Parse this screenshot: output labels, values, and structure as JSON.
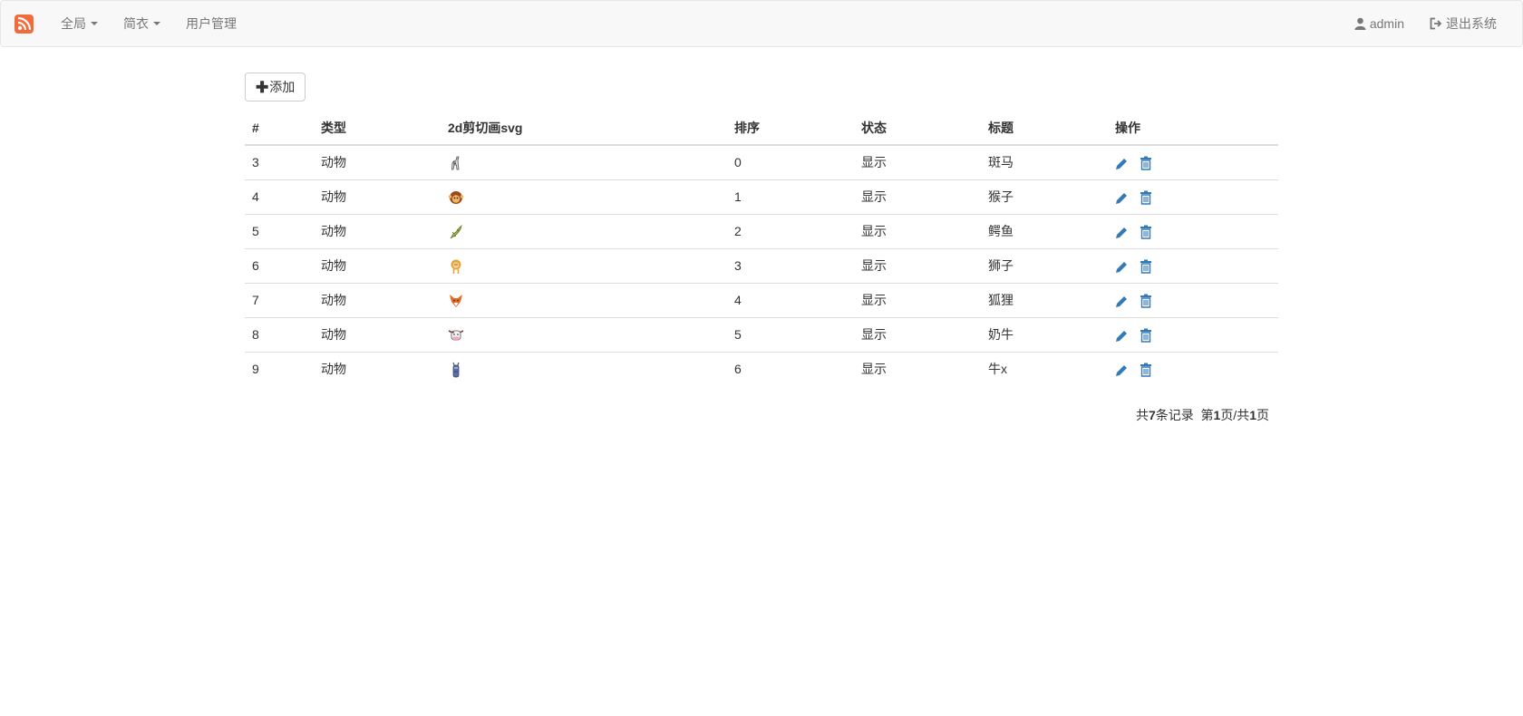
{
  "navbar": {
    "brand_icon": "rss-logo-icon",
    "brand_color": "#f26b3a",
    "menu": [
      {
        "label": "全局",
        "dropdown": true
      },
      {
        "label": "简衣",
        "dropdown": true
      },
      {
        "label": "用户管理",
        "dropdown": false
      }
    ],
    "user": {
      "label": "admin",
      "icon": "user-icon"
    },
    "logout": {
      "label": "退出系统",
      "icon": "logout-icon"
    }
  },
  "toolbar": {
    "add_label": "添加",
    "add_icon": "plus-icon"
  },
  "table": {
    "columns": [
      "#",
      "类型",
      "2d剪切画svg",
      "排序",
      "状态",
      "标题",
      "操作"
    ],
    "rows": [
      {
        "id": "3",
        "type": "动物",
        "image": "zebra-icon",
        "order": "0",
        "status": "显示",
        "title": "斑马"
      },
      {
        "id": "4",
        "type": "动物",
        "image": "monkey-icon",
        "order": "1",
        "status": "显示",
        "title": "猴子"
      },
      {
        "id": "5",
        "type": "动物",
        "image": "crocodile-icon",
        "order": "2",
        "status": "显示",
        "title": "鳄鱼"
      },
      {
        "id": "6",
        "type": "动物",
        "image": "lion-icon",
        "order": "3",
        "status": "显示",
        "title": "狮子"
      },
      {
        "id": "7",
        "type": "动物",
        "image": "fox-icon",
        "order": "4",
        "status": "显示",
        "title": "狐狸"
      },
      {
        "id": "8",
        "type": "动物",
        "image": "cow-icon",
        "order": "5",
        "status": "显示",
        "title": "奶牛"
      },
      {
        "id": "9",
        "type": "动物",
        "image": "bull-icon",
        "order": "6",
        "status": "显示",
        "title": "牛x"
      }
    ],
    "action_icons": [
      "pencil-icon",
      "trash-icon"
    ],
    "action_color": "#337ab7"
  },
  "pager": {
    "total_prefix": "共",
    "total_count": "7",
    "total_suffix": "条记录",
    "page_prefix": "第",
    "page_current": "1",
    "page_middle": "页/共",
    "page_total": "1",
    "page_suffix": "页"
  }
}
